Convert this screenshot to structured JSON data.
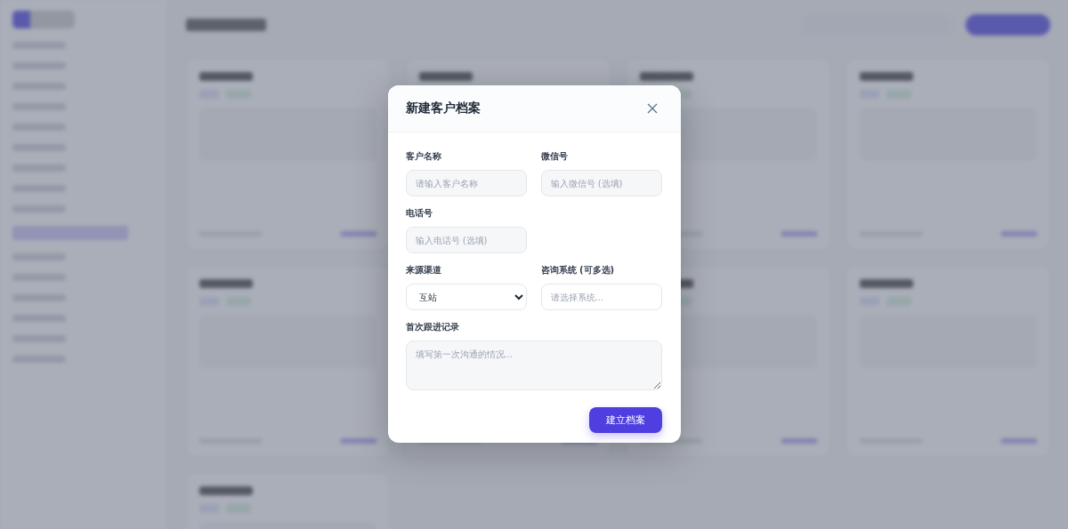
{
  "background": {
    "kind": "blurred"
  },
  "dialog": {
    "title": "新建客户档案",
    "fields": [
      {
        "kind": "text",
        "label": "客户名称",
        "placeholder": "请输入客户名称"
      },
      {
        "kind": "text",
        "label": "微信号",
        "placeholder": "输入微信号 (选填)"
      },
      {
        "kind": "text",
        "label": "电话号",
        "placeholder": "输入电话号 (选填)"
      },
      {
        "kind": "spacer"
      },
      {
        "kind": "select",
        "label": "来源渠道",
        "value": "互站"
      },
      {
        "kind": "picker",
        "label": "咨询系统 (可多选)",
        "placeholder": "请选择系统..."
      },
      {
        "kind": "textarea",
        "label": "首次跟进记录",
        "placeholder": "填写第一次沟通的情况..."
      }
    ],
    "submit": "建立档案"
  }
}
